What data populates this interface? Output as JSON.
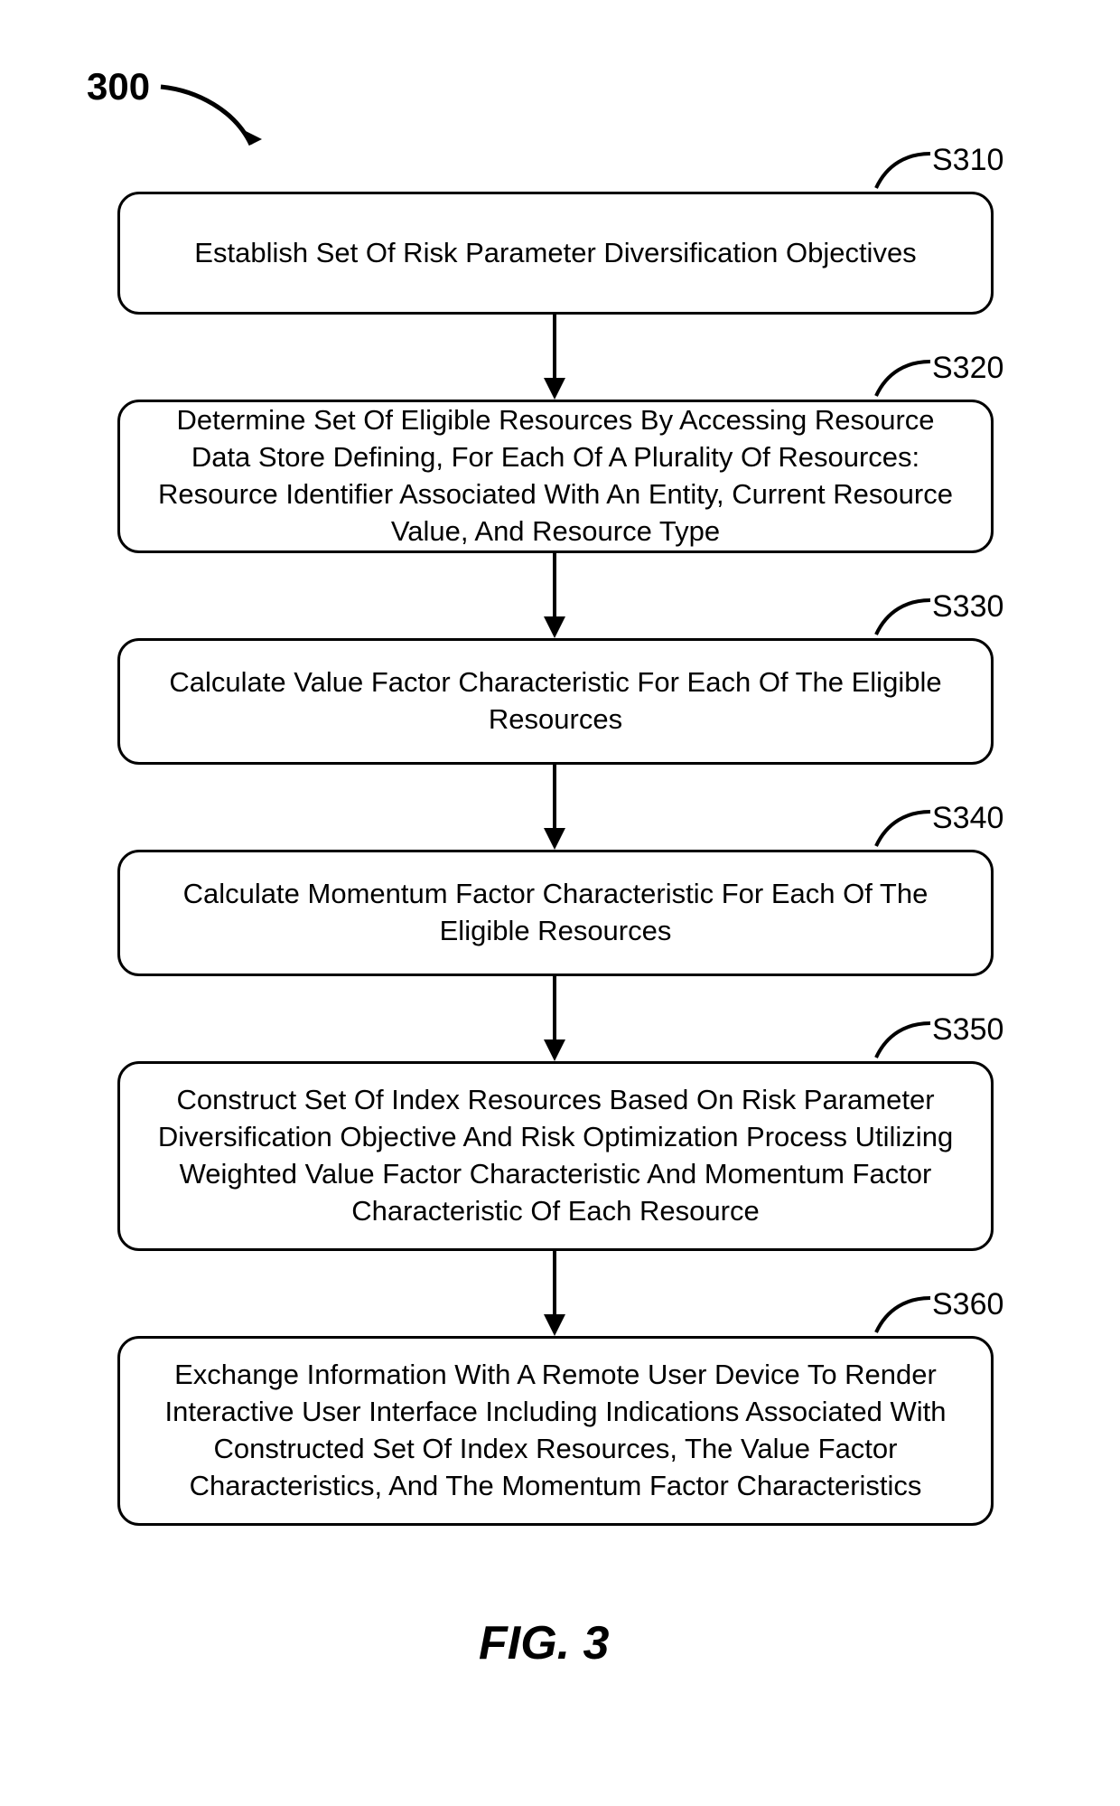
{
  "figureNumber": "300",
  "figureCaption": "FIG. 3",
  "steps": [
    {
      "label": "S310",
      "text": "Establish Set Of Risk Parameter Diversification Objectives"
    },
    {
      "label": "S320",
      "text": "Determine Set Of Eligible Resources By Accessing Resource Data Store Defining, For Each Of A Plurality Of Resources: Resource Identifier Associated With An Entity, Current Resource Value, And Resource Type"
    },
    {
      "label": "S330",
      "text": "Calculate Value Factor Characteristic For Each Of The Eligible Resources"
    },
    {
      "label": "S340",
      "text": "Calculate Momentum Factor Characteristic For Each Of The Eligible Resources"
    },
    {
      "label": "S350",
      "text": "Construct Set Of Index Resources Based On Risk Parameter Diversification Objective And Risk Optimization Process Utilizing Weighted Value Factor Characteristic And Momentum Factor Characteristic Of Each Resource"
    },
    {
      "label": "S360",
      "text": "Exchange Information With A Remote User Device To Render Interactive User Interface Including Indications Associated With Constructed Set Of Index Resources, The Value Factor Characteristics, And The Momentum Factor Characteristics"
    }
  ]
}
